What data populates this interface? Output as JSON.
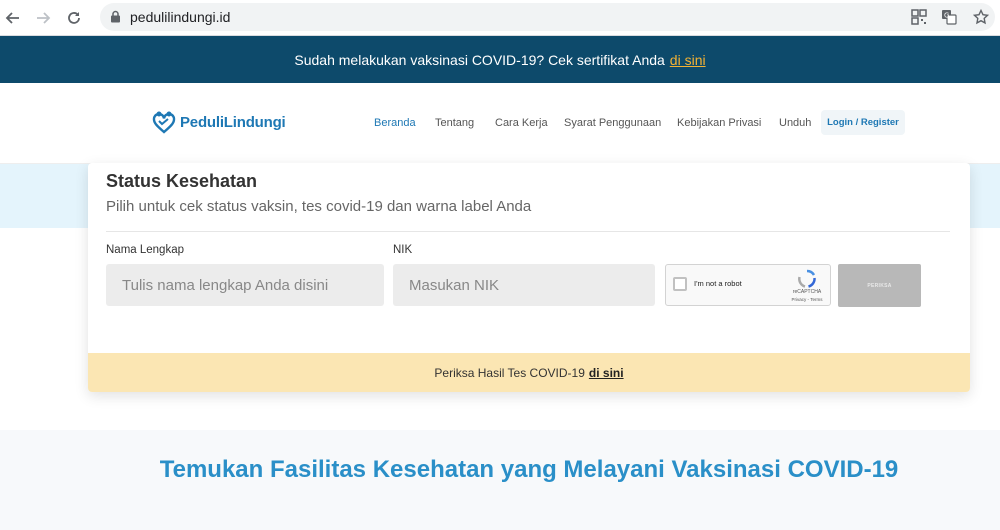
{
  "browser": {
    "url": "pedulilindungi.id",
    "icons": [
      "back-icon",
      "forward-icon",
      "reload-icon",
      "lock-icon",
      "qr-icon",
      "translate-icon",
      "star-icon"
    ]
  },
  "banner": {
    "text": "Sudah melakukan vaksinasi COVID-19? Cek sertifikat Anda",
    "link": "di sini",
    "bg_color": "#0d4a6b",
    "link_color": "#f3b234"
  },
  "header": {
    "logo_text": "PeduliLindungi",
    "nav": [
      {
        "label": "Beranda",
        "active": true
      },
      {
        "label": "Tentang",
        "active": false
      },
      {
        "label": "Cara Kerja",
        "active": false
      },
      {
        "label": "Syarat Penggunaan",
        "active": false
      },
      {
        "label": "Kebijakan Privasi",
        "active": false
      },
      {
        "label": "Unduh",
        "active": false
      }
    ],
    "login_label": "Login / Register",
    "accent_color": "#1e78b4"
  },
  "status_card": {
    "title": "Status Kesehatan",
    "subtitle": "Pilih untuk cek status vaksin, tes covid-19 dan warna label Anda",
    "name_label": "Nama Lengkap",
    "name_placeholder": "Tulis nama lengkap Anda disini",
    "nik_label": "NIK",
    "nik_placeholder": "Masukan NIK",
    "captcha": {
      "label": "I'm not a robot",
      "brand": "reCAPTCHA",
      "terms": "Privacy - Terms"
    },
    "check_button": "PERIKSA",
    "footer_text": "Periksa Hasil Tes COVID-19",
    "footer_link": "di sini"
  },
  "lower": {
    "title": "Temukan Fasilitas Kesehatan yang Melayani Vaksinasi COVID-19",
    "title_color": "#2a8fc8"
  }
}
